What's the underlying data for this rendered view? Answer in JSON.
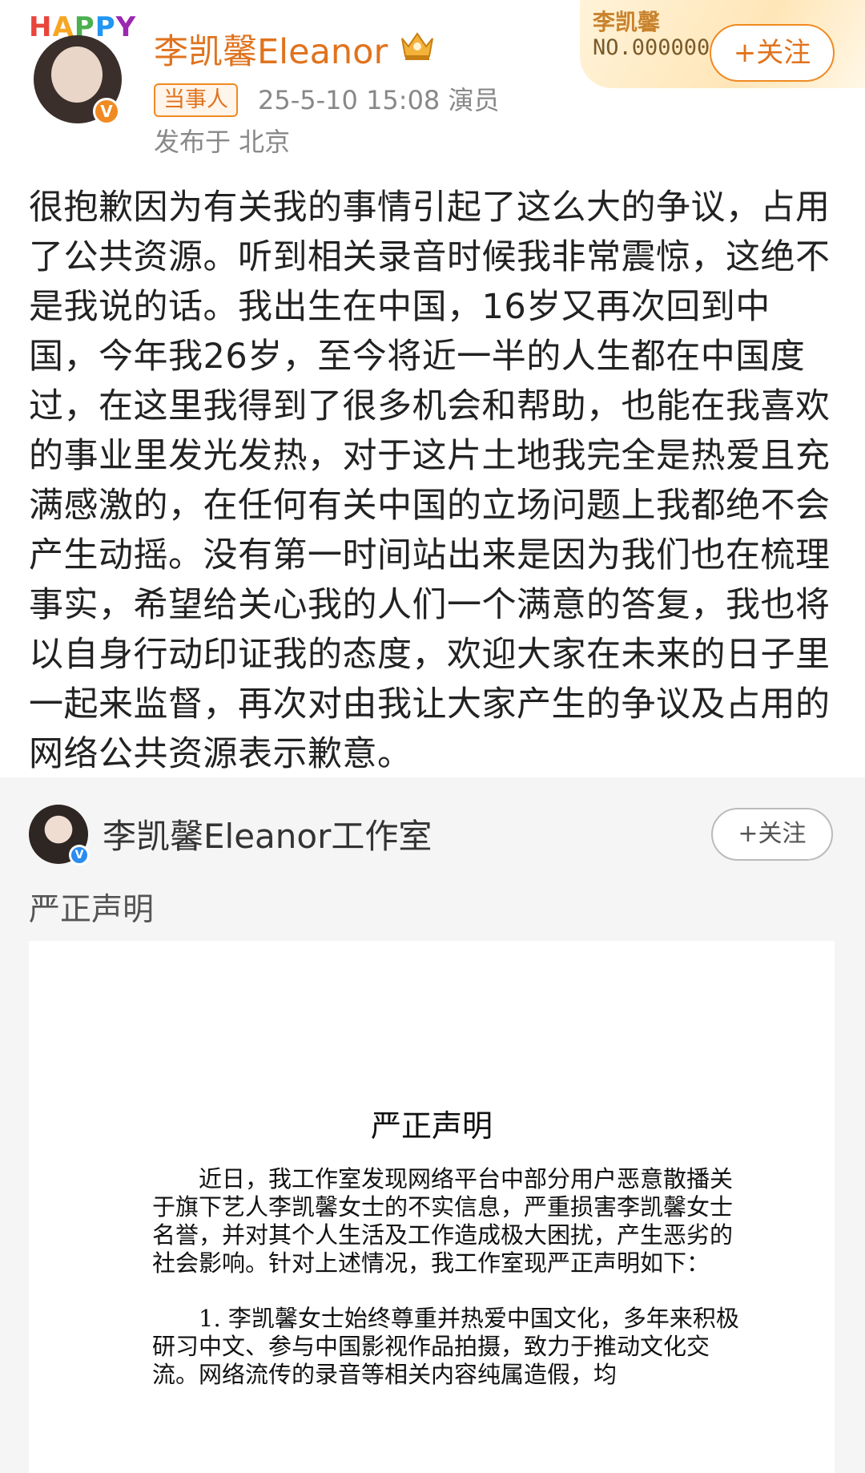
{
  "header": {
    "avatar_frame_text": "HAPPY",
    "username": "李凯馨Eleanor",
    "tag": "当事人",
    "meta": "25-5-10 15:08   演员",
    "location": "发布于 北京",
    "fan_card": {
      "name": "李凯馨",
      "number": "NO.000000"
    },
    "follow_label": "+关注"
  },
  "post": {
    "text": "很抱歉因为有关我的事情引起了这么大的争议，占用了公共资源。听到相关录音时候我非常震惊，这绝不是我说的话。我出生在中国，16岁又再次回到中国，今年我26岁，至今将近一半的人生都在中国度过，在这里我得到了很多机会和帮助，也能在我喜欢的事业里发光发热，对于这片土地我完全是热爱且充满感激的，在任何有关中国的立场问题上我都绝不会产生动摇。没有第一时间站出来是因为我们也在梳理事实，希望给关心我的人们一个满意的答复，我也将以自身行动印证我的态度，欢迎大家在未来的日子里一起来监督，再次对由我让大家产生的争议及占用的网络公共资源表示歉意。"
  },
  "repost": {
    "name": "李凯馨Eleanor工作室",
    "follow_label": "+关注",
    "text": "严正声明",
    "document": {
      "title": "严正声明",
      "paragraph1": "　　近日，我工作室发现网络平台中部分用户恶意散播关于旗下艺人李凯馨女士的不实信息，严重损害李凯馨女士名誉，并对其个人生活及工作造成极大困扰，产生恶劣的社会影响。针对上述情况，我工作室现严正声明如下：",
      "paragraph2": "　　1. 李凯馨女士始终尊重并热爱中国文化，多年来积极研习中文、参与中国影视作品拍摄，致力于推动文化交流。网络流传的录音等相关内容纯属造假，均"
    }
  },
  "colors": {
    "accent_orange": "#e0731e",
    "repost_bg": "#f5f5f5"
  }
}
